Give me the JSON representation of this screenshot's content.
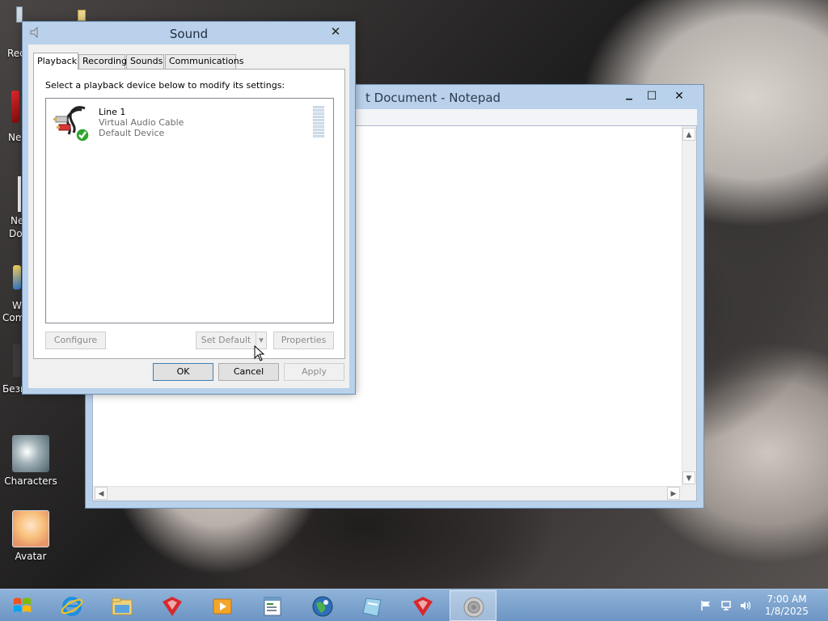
{
  "desktop": {
    "partial_labels": [
      "Rec",
      "Ne",
      "Ne",
      "Do",
      "W",
      "Com",
      "Безь"
    ],
    "icons": [
      {
        "label": "Characters"
      },
      {
        "label": "Avatar"
      }
    ]
  },
  "notepad": {
    "title": "t Document - Notepad",
    "controls": {
      "minimize": "▁",
      "maximize": "☐",
      "close": "✕"
    },
    "scroll": {
      "up": "▲",
      "down": "▼",
      "left": "◀",
      "right": "▶"
    }
  },
  "sound": {
    "title": "Sound",
    "close": "✕",
    "tabs": [
      "Playback",
      "Recording",
      "Sounds",
      "Communications"
    ],
    "active_tab": "Playback",
    "instruction": "Select a playback device below to modify its settings:",
    "device": {
      "name": "Line 1",
      "description": "Virtual Audio Cable",
      "status": "Default Device"
    },
    "buttons": {
      "configure": "Configure",
      "set_default": "Set Default",
      "set_default_arrow": "▾",
      "properties": "Properties",
      "ok": "OK",
      "cancel": "Cancel",
      "apply": "Apply"
    }
  },
  "taskbar": {
    "items": [
      "start-button",
      "internet-explorer",
      "file-explorer",
      "app-red-1",
      "media-player",
      "notepad",
      "browser-globe",
      "app-notes",
      "app-red-2",
      "sound"
    ],
    "active_item": "sound",
    "clock": {
      "time": "7:00 AM",
      "date": "1/8/2025"
    }
  },
  "colors": {
    "window_frame": "#b9d1ea",
    "taskbar": "#7ea3ce",
    "accent_check": "#2fa52f"
  }
}
